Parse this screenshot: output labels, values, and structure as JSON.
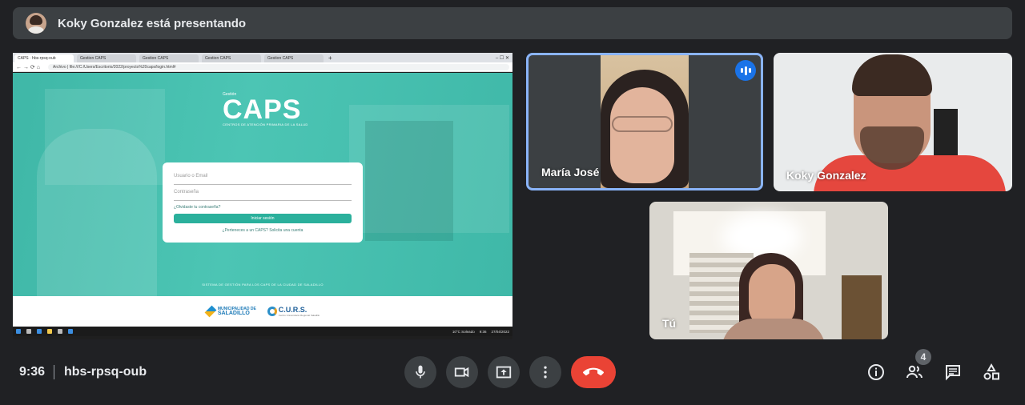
{
  "banner": {
    "text": "Koky Gonzalez está presentando"
  },
  "browser": {
    "tabs": [
      "CAPS · hbs-rpsq-oub",
      "Gestion CAPS",
      "Gestion CAPS",
      "Gestion CAPS",
      "Gestion CAPS"
    ],
    "url": "Archivo | file:///C:/Users/Escritorio/2022/proyecto%20caps/login.html#"
  },
  "site": {
    "brand_small": "Gestión",
    "brand": "CAPS",
    "brand_sub": "CENTROS DE ATENCIÓN PRIMARIA DE LA SALUD",
    "login": {
      "user_placeholder": "Usuario o Email",
      "password_placeholder": "Contraseña",
      "forgot": "¿Olvidaste tu contraseña?",
      "submit": "Iniciar sesión",
      "register": "¿Perteneces a un CAPS? Solicita una cuenta"
    },
    "footer_text": "SISTEMA DE GESTIÓN PARA LOS CAPS DE LA CIUDAD DE SALADILLO",
    "logo1_top": "MUNICIPALIDAD DE",
    "logo1_name": "SALADILLO",
    "logo2_name": "C.U.R.S.",
    "logo2_sub": "Centro Universitario Regional Saladillo"
  },
  "taskbar": {
    "weather": "10°C Soleado",
    "clock_time": "9:36",
    "clock_date": "27/04/2022"
  },
  "participants": [
    {
      "name": "María José",
      "speaking": true
    },
    {
      "name": "Koky Gonzalez",
      "speaking": false
    },
    {
      "name": "Tú",
      "speaking": false
    }
  ],
  "meeting": {
    "time": "9:36",
    "code": "hbs-rpsq-oub",
    "participant_count": "4"
  },
  "colors": {
    "accent": "#8ab4f8",
    "hangup": "#ea4335",
    "control_bg": "#3c4043",
    "background": "#202124",
    "site_teal": "#45bdac"
  },
  "icons": [
    "mic-icon",
    "camera-icon",
    "present-icon",
    "more-options-icon",
    "hang-up-icon",
    "info-icon",
    "people-icon",
    "chat-icon",
    "activities-icon"
  ]
}
